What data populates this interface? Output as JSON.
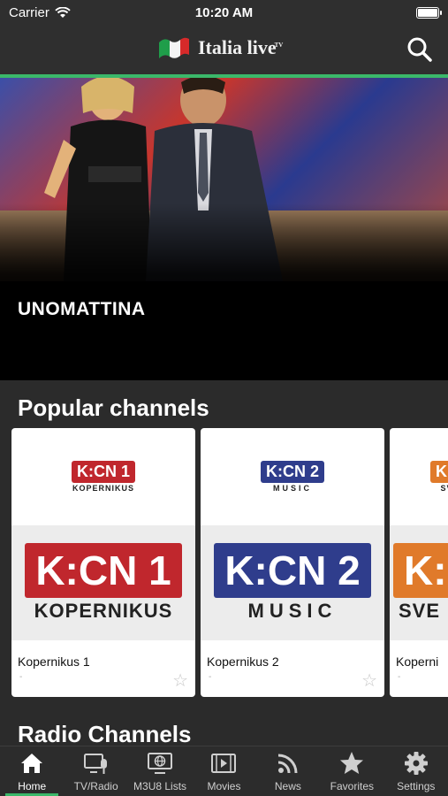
{
  "status": {
    "carrier": "Carrier",
    "time": "10:20 AM",
    "battery_level": 1.0
  },
  "app": {
    "title": "Italia live",
    "title_suffix": "TV"
  },
  "hero": {
    "title": "UNOMATTINA"
  },
  "sections": {
    "popular": "Popular channels",
    "radio": "Radio Channels"
  },
  "channels": [
    {
      "name": "Kopernikus 1",
      "sub": "-",
      "logo_top": "K:CN",
      "logo_num": "1",
      "logo_sub": "KOPERNIKUS",
      "color": "#c0272d"
    },
    {
      "name": "Kopernikus 2",
      "sub": "-",
      "logo_top": "K:CN",
      "logo_num": "2",
      "logo_sub": "MUSIC",
      "color": "#2f3d8c"
    },
    {
      "name": "Koperni",
      "sub": "-",
      "logo_top": "K:C",
      "logo_num": "",
      "logo_sub": "SVE",
      "color": "#e07a2a"
    }
  ],
  "tabs": [
    {
      "label": "Home",
      "icon": "home-icon",
      "active": true
    },
    {
      "label": "TV/Radio",
      "icon": "tv-radio-icon",
      "active": false
    },
    {
      "label": "M3U8 Lists",
      "icon": "m3u8-list-icon",
      "active": false
    },
    {
      "label": "Movies",
      "icon": "movies-icon",
      "active": false
    },
    {
      "label": "News",
      "icon": "news-rss-icon",
      "active": false
    },
    {
      "label": "Favorites",
      "icon": "star-icon",
      "active": false
    },
    {
      "label": "Settings",
      "icon": "gear-icon",
      "active": false
    }
  ],
  "colors": {
    "accent": "#3bb86a",
    "background": "#2b2b2b",
    "bar": "#2f2f2f"
  }
}
